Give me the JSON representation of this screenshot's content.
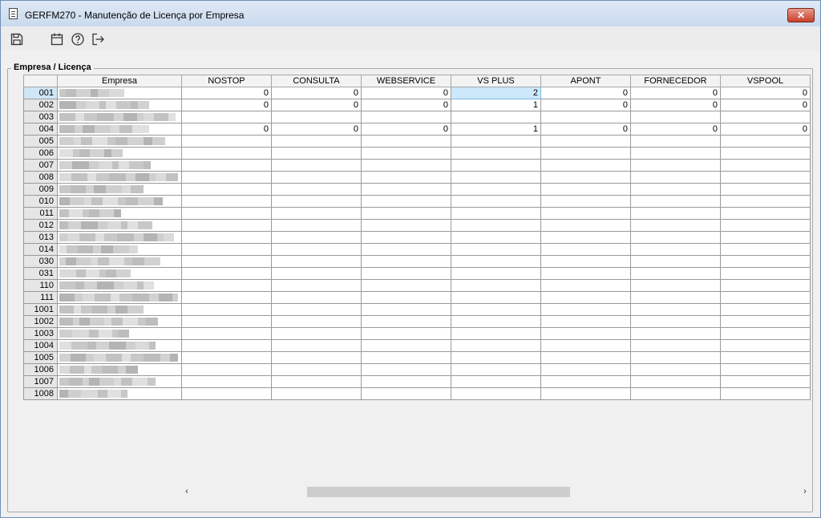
{
  "window": {
    "title": "GERFM270 - Manutenção de Licença por Empresa",
    "close_label": "✕"
  },
  "toolbar": {
    "icons": [
      "save-icon",
      "calendar-icon",
      "help-icon",
      "exit-icon"
    ]
  },
  "group": {
    "label": "Empresa / Licença"
  },
  "grid": {
    "headers": [
      "Empresa",
      "NOSTOP",
      "CONSULTA",
      "WEBSERVICE",
      "VS PLUS",
      "APONT",
      "FORNECEDOR",
      "VSPOOL"
    ],
    "rows": [
      {
        "id": "001",
        "values": [
          "0",
          "0",
          "0",
          "2",
          "0",
          "0",
          "0"
        ]
      },
      {
        "id": "002",
        "values": [
          "0",
          "0",
          "0",
          "1",
          "0",
          "0",
          "0"
        ]
      },
      {
        "id": "003",
        "values": [
          "",
          "",
          "",
          "",
          "",
          "",
          ""
        ]
      },
      {
        "id": "004",
        "values": [
          "0",
          "0",
          "0",
          "1",
          "0",
          "0",
          "0"
        ]
      },
      {
        "id": "005",
        "values": [
          "",
          "",
          "",
          "",
          "",
          "",
          ""
        ]
      },
      {
        "id": "006",
        "values": [
          "",
          "",
          "",
          "",
          "",
          "",
          ""
        ]
      },
      {
        "id": "007",
        "values": [
          "",
          "",
          "",
          "",
          "",
          "",
          ""
        ]
      },
      {
        "id": "008",
        "values": [
          "",
          "",
          "",
          "",
          "",
          "",
          ""
        ]
      },
      {
        "id": "009",
        "values": [
          "",
          "",
          "",
          "",
          "",
          "",
          ""
        ]
      },
      {
        "id": "010",
        "values": [
          "",
          "",
          "",
          "",
          "",
          "",
          ""
        ]
      },
      {
        "id": "011",
        "values": [
          "",
          "",
          "",
          "",
          "",
          "",
          ""
        ]
      },
      {
        "id": "012",
        "values": [
          "",
          "",
          "",
          "",
          "",
          "",
          ""
        ]
      },
      {
        "id": "013",
        "values": [
          "",
          "",
          "",
          "",
          "",
          "",
          ""
        ]
      },
      {
        "id": "014",
        "values": [
          "",
          "",
          "",
          "",
          "",
          "",
          ""
        ]
      },
      {
        "id": "030",
        "values": [
          "",
          "",
          "",
          "",
          "",
          "",
          ""
        ]
      },
      {
        "id": "031",
        "values": [
          "",
          "",
          "",
          "",
          "",
          "",
          ""
        ]
      },
      {
        "id": "110",
        "values": [
          "",
          "",
          "",
          "",
          "",
          "",
          ""
        ]
      },
      {
        "id": "111",
        "values": [
          "",
          "",
          "",
          "",
          "",
          "",
          ""
        ]
      },
      {
        "id": "1001",
        "values": [
          "",
          "",
          "",
          "",
          "",
          "",
          ""
        ]
      },
      {
        "id": "1002",
        "values": [
          "",
          "",
          "",
          "",
          "",
          "",
          ""
        ]
      },
      {
        "id": "1003",
        "values": [
          "",
          "",
          "",
          "",
          "",
          "",
          ""
        ]
      },
      {
        "id": "1004",
        "values": [
          "",
          "",
          "",
          "",
          "",
          "",
          ""
        ]
      },
      {
        "id": "1005",
        "values": [
          "",
          "",
          "",
          "",
          "",
          "",
          ""
        ]
      },
      {
        "id": "1006",
        "values": [
          "",
          "",
          "",
          "",
          "",
          "",
          ""
        ]
      },
      {
        "id": "1007",
        "values": [
          "",
          "",
          "",
          "",
          "",
          "",
          ""
        ]
      },
      {
        "id": "1008",
        "values": [
          "",
          "",
          "",
          "",
          "",
          "",
          ""
        ]
      }
    ]
  },
  "scrollbar": {
    "left_arrow": "‹",
    "right_arrow": "›"
  }
}
